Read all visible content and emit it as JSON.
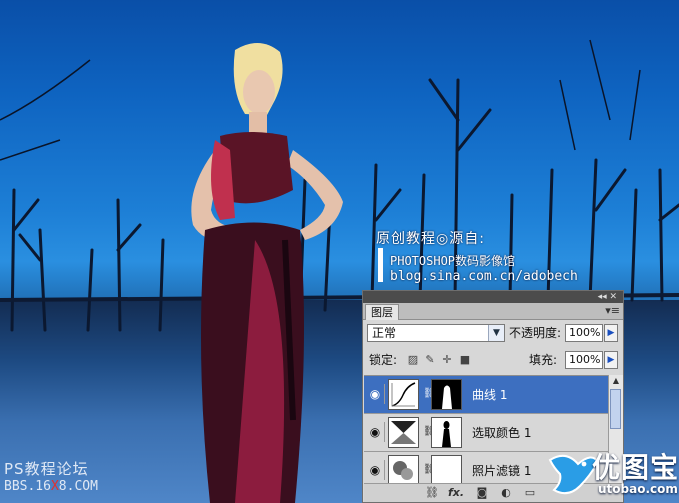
{
  "watermark": {
    "credit_line1": "原创教程◎源自:",
    "credit_line2": "PHOTOSHOP数码影像馆",
    "credit_line3": "blog.sina.com.cn/adobech",
    "forum_name": "PS教程论坛",
    "forum_url_prefix": "BBS.16",
    "forum_url_mid": "X",
    "forum_url_suffix": "8.COM",
    "brand_name": "优图宝",
    "brand_url": "utobao.com"
  },
  "layers_panel": {
    "collapse_icon": "double-chevron-icon",
    "tab_label": "图层",
    "blend_mode": "正常",
    "opacity_label": "不透明度:",
    "opacity_value": "100%",
    "lock_label": "锁定:",
    "fill_label": "填充:",
    "fill_value": "100%",
    "layers": [
      {
        "name": "曲线 1",
        "selected": true,
        "thumb_icon": "curves-adjustment-icon"
      },
      {
        "name": "选取颜色 1",
        "selected": false,
        "thumb_icon": "selective-color-adjustment-icon"
      },
      {
        "name": "照片滤镜 1",
        "selected": false,
        "thumb_icon": "photo-filter-adjustment-icon"
      }
    ],
    "bottom_icons": [
      "link-icon",
      "fx-icon",
      "mask-icon",
      "adjustment-icon",
      "group-icon",
      "new-layer-icon",
      "trash-icon"
    ],
    "fx_label": "fx."
  },
  "colors": {
    "sky": "#1577cc",
    "selection": "#3d6fc0",
    "panel_bg": "#d7d7d7"
  }
}
